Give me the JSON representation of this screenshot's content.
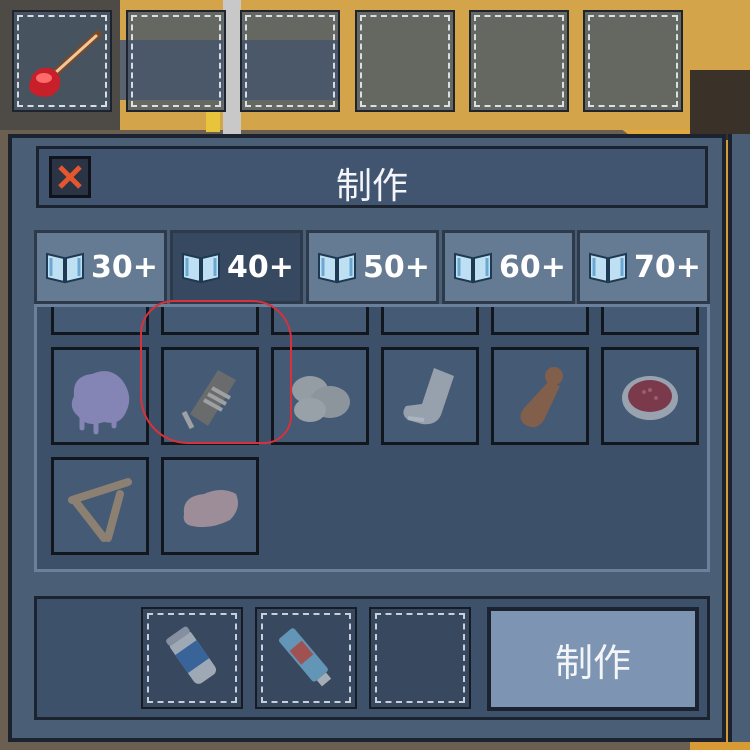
{
  "hotbar": {
    "slots": [
      {
        "item_icon": "plunger-icon"
      },
      {
        "item_icon": ""
      },
      {
        "item_icon": ""
      },
      {
        "item_icon": ""
      },
      {
        "item_icon": ""
      },
      {
        "item_icon": ""
      }
    ]
  },
  "craft_panel": {
    "title": "制作",
    "close_icon": "close-icon",
    "tabs": [
      {
        "label": "30+",
        "icon": "book-icon",
        "active": false
      },
      {
        "label": "40+",
        "icon": "book-icon",
        "active": true
      },
      {
        "label": "50+",
        "icon": "book-icon",
        "active": false
      },
      {
        "label": "60+",
        "icon": "book-icon",
        "active": false
      },
      {
        "label": "70+",
        "icon": "book-icon",
        "active": false
      }
    ],
    "recipes": [
      {
        "icon": "purple-goo-icon"
      },
      {
        "icon": "washboard-icon"
      },
      {
        "icon": "soap-rock-icon"
      },
      {
        "icon": "sock-icon"
      },
      {
        "icon": "pepper-grinder-icon"
      },
      {
        "icon": "red-bowl-icon"
      },
      {
        "icon": "wooden-frame-icon"
      },
      {
        "icon": "dough-icon"
      }
    ],
    "ingredients": [
      {
        "icon": "talcum-powder-icon"
      },
      {
        "icon": "toothpaste-icon"
      },
      {
        "icon": ""
      }
    ],
    "craft_button_label": "制作"
  },
  "colors": {
    "panel": "#4a5e76",
    "tab_active": "#364960",
    "tab_inactive": "#657a93",
    "highlight": "#d8313c",
    "close_x": "#e4572e"
  }
}
